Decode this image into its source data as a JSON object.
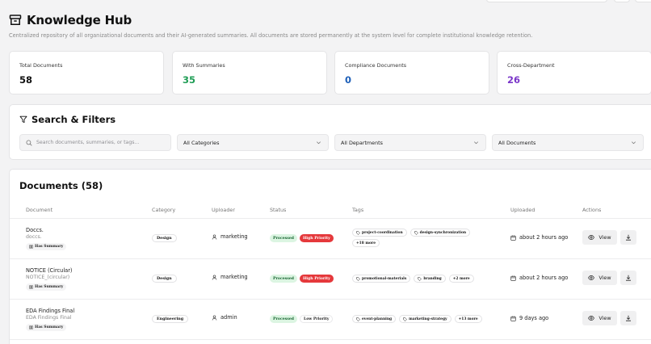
{
  "header": {
    "title": "Knowledge Hub",
    "description": "Centralized repository of all organizational documents and their AI-generated summaries. All documents are stored permanently at the system level for complete institutional knowledge retention."
  },
  "stats": [
    {
      "label": "Total Documents",
      "value": "58",
      "color": "#111111"
    },
    {
      "label": "With Summaries",
      "value": "35",
      "color": "#1f9d55"
    },
    {
      "label": "Compliance Documents",
      "value": "0",
      "color": "#1d5fb8"
    },
    {
      "label": "Cross-Department",
      "value": "26",
      "color": "#7a36c9"
    }
  ],
  "filters": {
    "title": "Search & Filters",
    "search_placeholder": "Search documents, summaries, or tags...",
    "category": "All Categories",
    "department": "All Departments",
    "documents": "All Documents"
  },
  "documents": {
    "title": "Documents (58)",
    "columns": [
      "Document",
      "Category",
      "Uploader",
      "Status",
      "Tags",
      "Uploaded",
      "Actions"
    ],
    "rows": [
      {
        "name": "Doccs.",
        "filename": "doccs.",
        "summary_badge": "Has Summary",
        "category": "Design",
        "uploader": "marketing",
        "status": "Processed",
        "priority": "High Priority",
        "tags": [
          "project-coordination",
          "design-synchronization"
        ],
        "more_tags": "+18 more",
        "uploaded": "about 2 hours ago",
        "view_label": "View"
      },
      {
        "name": "NOTICE (Circular)",
        "filename": "NOTICE_(circular)",
        "summary_badge": "Has Summary",
        "category": "Design",
        "uploader": "marketing",
        "status": "Processed",
        "priority": "High Priority",
        "tags": [
          "promotional-materials",
          "branding"
        ],
        "more_tags": "+2 more",
        "uploaded": "about 2 hours ago",
        "view_label": "View"
      },
      {
        "name": "EDA Findings Final",
        "filename": "EDA Findings Final",
        "summary_badge": "Has Summary",
        "category": "Engineering",
        "uploader": "admin",
        "status": "Processed",
        "priority": "Low Priority",
        "tags": [
          "event-planning",
          "marketing-strategy"
        ],
        "more_tags": "+13 more",
        "uploaded": "9 days ago",
        "view_label": "View"
      }
    ]
  },
  "colors": {
    "processed_bg": "#dcf5e2",
    "high_priority": "#e5383b",
    "summaries_value": "#1f9d55",
    "compliance_value": "#1d5fb8",
    "cross_dept_value": "#7a36c9"
  },
  "icons": [
    "archive-icon",
    "filter-icon",
    "search-icon",
    "chevron-down-icon",
    "user-icon",
    "calendar-icon",
    "eye-icon",
    "download-icon",
    "tag-icon",
    "book-icon"
  ]
}
